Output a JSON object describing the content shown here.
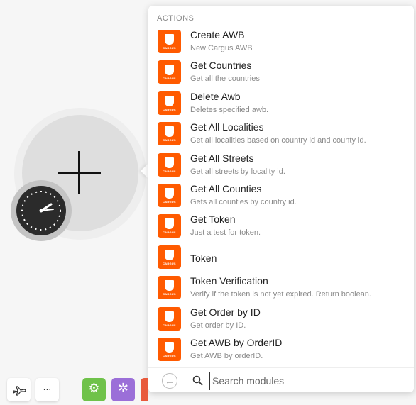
{
  "section_title": "ACTIONS",
  "icon_word": "CARGUS",
  "accent_color": "#ff5a00",
  "items": [
    {
      "title": "Create AWB",
      "desc": "New Cargus AWB"
    },
    {
      "title": "Get Countries",
      "desc": "Get all the countries"
    },
    {
      "title": "Delete Awb",
      "desc": "Deletes specified awb."
    },
    {
      "title": "Get All Localities",
      "desc": "Get all localities based on country id and county id."
    },
    {
      "title": "Get All Streets",
      "desc": "Get all streets by locality id."
    },
    {
      "title": "Get All Counties",
      "desc": "Gets all counties by country id."
    },
    {
      "title": "Get Token",
      "desc": "Just a test for token."
    },
    {
      "title": "Token",
      "desc": ""
    },
    {
      "title": "Token Verification",
      "desc": "Verify if the token is not yet expired. Return boolean."
    },
    {
      "title": "Get Order by ID",
      "desc": "Get order by ID."
    },
    {
      "title": "Get AWB by OrderID",
      "desc": "Get AWB by orderID."
    }
  ],
  "search": {
    "placeholder": "Search modules"
  },
  "toolbar": {
    "more_label": "..."
  }
}
